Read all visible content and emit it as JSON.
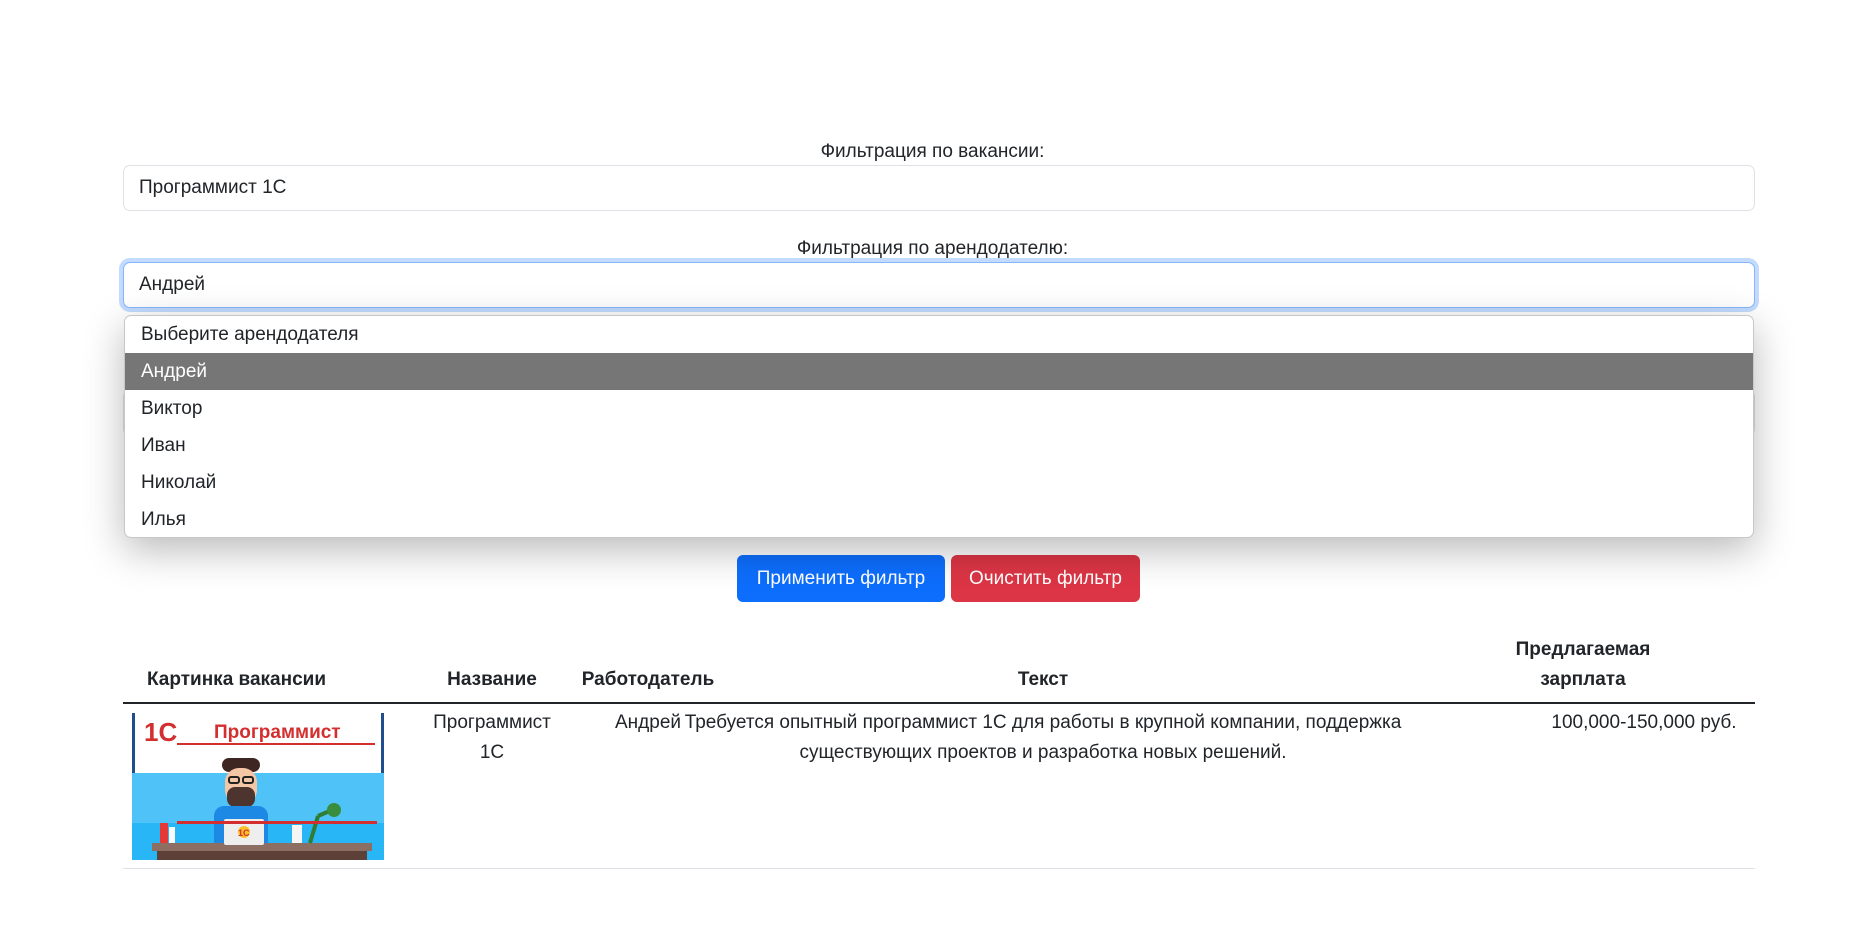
{
  "filters": {
    "vacancy": {
      "label": "Фильтрация по вакансии:",
      "value": "Программист 1С"
    },
    "employer": {
      "label": "Фильтрация по арендодателю:",
      "value": "Андрей",
      "options": [
        "Выберите арендодателя",
        "Андрей",
        "Виктор",
        "Иван",
        "Николай",
        "Илья"
      ],
      "selected_index": 1
    }
  },
  "buttons": {
    "apply": "Применить фильтр",
    "clear": "Очистить фильтр"
  },
  "table": {
    "headers": {
      "image": "Картинка вакансии",
      "title": "Название",
      "employer": "Работодатель",
      "text": "Текст",
      "salary_line1": "Предлагаемая",
      "salary_line2": "зарплата"
    },
    "rows": [
      {
        "image_caption": "1С Программист",
        "image_logo": "1С",
        "image_word": "Программист",
        "title_line1": "Программист",
        "title_line2": "1С",
        "employer": "Андрей",
        "text_line1": "Требуется опытный программист 1С для работы в крупной компании, поддержка",
        "text_line2": "существующих проектов и разработка новых решений.",
        "salary": "100,000-150,000 руб."
      }
    ]
  },
  "colors": {
    "primary": "#0d6efd",
    "danger": "#dc3545",
    "selected_option": "#767676",
    "focus_border": "#86b7fe"
  }
}
